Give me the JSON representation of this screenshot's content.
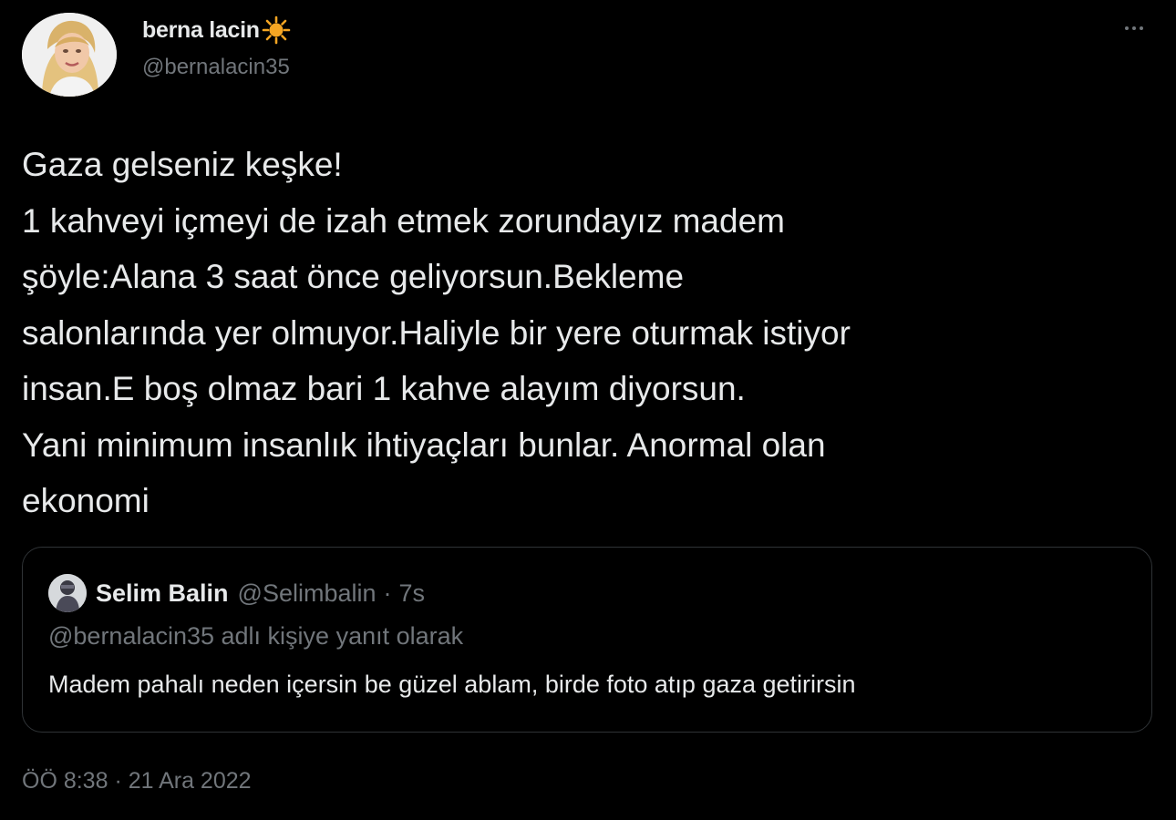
{
  "author": {
    "display_name": "berna lacin",
    "display_name_emoji_icon": "sun-icon",
    "handle": "@bernalacin35"
  },
  "tweet": {
    "lines": [
      "Gaza gelseniz keşke!",
      "1 kahveyi içmeyi de izah etmek zorundayız madem",
      "şöyle:Alana 3 saat önce geliyorsun.Bekleme",
      "salonlarında yer olmuyor.Haliyle bir yere oturmak istiyor",
      "insan.E boş olmaz bari 1 kahve alayım diyorsun.",
      "Yani minimum insanlık ihtiyaçları bunlar. Anormal olan",
      "ekonomi"
    ],
    "timestamp": "ÖÖ 8:38 · 21 Ara 2022"
  },
  "quoted_tweet": {
    "name": "Selim Balin",
    "handle": "@Selimbalin",
    "separator": "·",
    "time": "7s",
    "reply_context": "@bernalacin35 adlı kişiye yanıt olarak",
    "text": "Madem pahalı neden içersin be güzel ablam, birde foto atıp gaza getirirsin"
  },
  "icons": {
    "more": "more-horizontal-icon",
    "emoji": "sun-icon"
  },
  "colors": {
    "background": "#000000",
    "primary_text": "#e7e9ea",
    "secondary_text": "#71767b",
    "border": "#2f3336",
    "sun_emoji": "#f5a623"
  }
}
